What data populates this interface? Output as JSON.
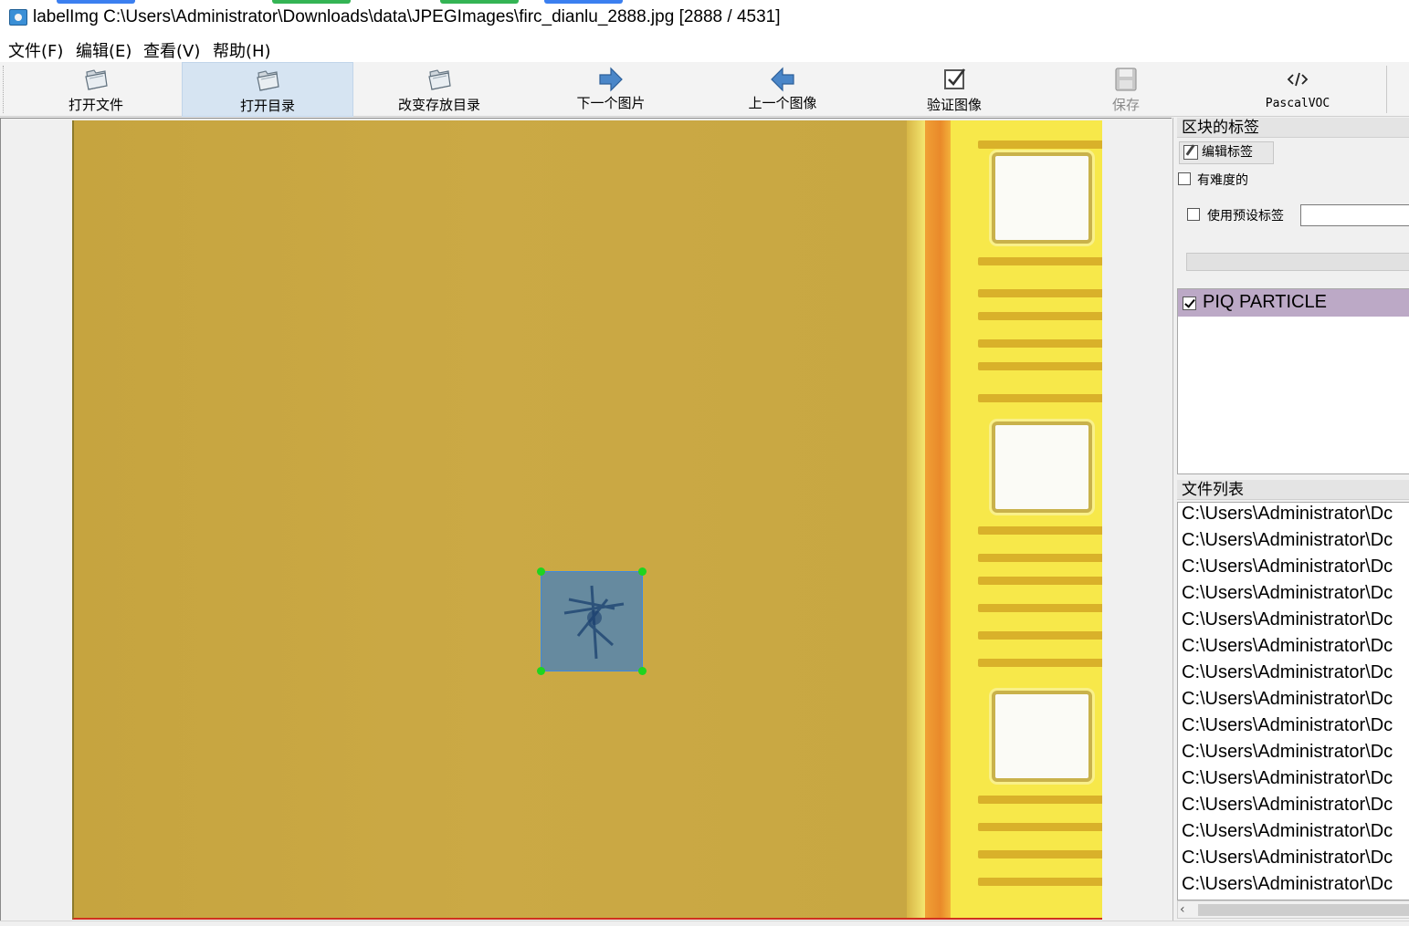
{
  "window": {
    "title": "labelImg C:\\Users\\Administrator\\Downloads\\data\\JPEGImages\\firc_dianlu_2888.jpg [2888 / 4531]",
    "app_icon": "labelimg-app-icon"
  },
  "menu": {
    "items": [
      {
        "label": "文件(F)"
      },
      {
        "label": "编辑(E)"
      },
      {
        "label": "查看(V)"
      },
      {
        "label": "帮助(H)"
      }
    ]
  },
  "toolbar": {
    "open_file": {
      "label": "打开文件",
      "icon": "folder-icon"
    },
    "open_dir": {
      "label": "打开目录",
      "icon": "folder-icon",
      "active": true
    },
    "change_save_dir": {
      "label": "改变存放目录",
      "icon": "folder-icon"
    },
    "next_image": {
      "label": "下一个图片",
      "icon": "arrow-right-icon"
    },
    "prev_image": {
      "label": "上一个图像",
      "icon": "arrow-left-icon"
    },
    "verify_image": {
      "label": "验证图像",
      "icon": "checkbox-icon"
    },
    "save": {
      "label": "保存",
      "icon": "save-icon",
      "disabled": true
    },
    "format": {
      "label": "PascalVOC",
      "icon": "code-icon"
    }
  },
  "canvas": {
    "annotation": {
      "label": "PIQ PARTICLE",
      "fill": "#2878d7",
      "vertex_color": "#1fd41f"
    }
  },
  "dock": {
    "box_labels": {
      "title": "区块的标签",
      "edit_label_button": "编辑标签",
      "difficult_label": "有难度的",
      "difficult_checked": false,
      "use_default_label": "使用预设标签",
      "use_default_checked": false,
      "default_label_value": "",
      "labels": [
        {
          "text": "PIQ PARTICLE",
          "checked": true,
          "highlight": "#bca9c6"
        }
      ]
    },
    "file_list": {
      "title": "文件列表",
      "items": [
        "C:\\Users\\Administrator\\Dc",
        "C:\\Users\\Administrator\\Dc",
        "C:\\Users\\Administrator\\Dc",
        "C:\\Users\\Administrator\\Dc",
        "C:\\Users\\Administrator\\Dc",
        "C:\\Users\\Administrator\\Dc",
        "C:\\Users\\Administrator\\Dc",
        "C:\\Users\\Administrator\\Dc",
        "C:\\Users\\Administrator\\Dc",
        "C:\\Users\\Administrator\\Dc",
        "C:\\Users\\Administrator\\Dc",
        "C:\\Users\\Administrator\\Dc",
        "C:\\Users\\Administrator\\Dc",
        "C:\\Users\\Administrator\\Dc",
        "C:\\Users\\Administrator\\Dc"
      ],
      "scroll_left_icon": "chevron-left-icon"
    }
  },
  "colors": {
    "toolbar_active": "#d6e4f2",
    "selected_label_bg": "#bca9c6",
    "image_base": "#c8a742",
    "image_stripe": "#e9892a",
    "image_band": "#f7e84a"
  }
}
